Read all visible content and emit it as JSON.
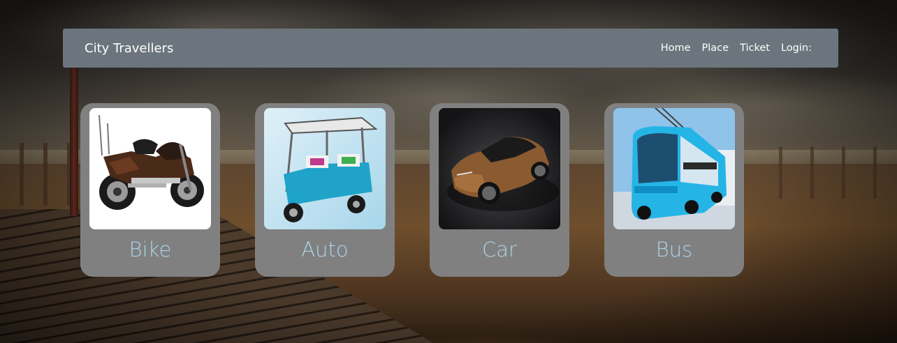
{
  "navbar": {
    "brand": "City Travellers",
    "links": [
      "Home",
      "Place",
      "Ticket",
      "Login:"
    ],
    "background": "#6c757d",
    "text_color": "#ffffff"
  },
  "vehicles": [
    {
      "label": "Bike",
      "icon": "motorcycle-image"
    },
    {
      "label": "Auto",
      "icon": "auto-rickshaw-image"
    },
    {
      "label": "Car",
      "icon": "sports-car-image"
    },
    {
      "label": "Bus",
      "icon": "electric-bus-image"
    }
  ],
  "card_style": {
    "background": "#808080",
    "label_color": "#a9d4ea"
  }
}
